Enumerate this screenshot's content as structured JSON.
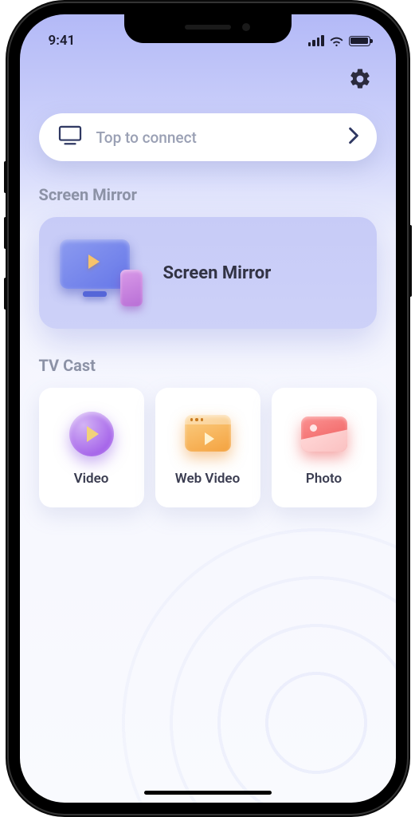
{
  "status": {
    "time": "9:41"
  },
  "connect": {
    "placeholder": "Top to connect"
  },
  "sections": {
    "mirror_title": "Screen Mirror",
    "mirror_card_label": "Screen Mirror",
    "cast_title": "TV Cast",
    "cast_items": [
      {
        "label": "Video"
      },
      {
        "label": "Web Video"
      },
      {
        "label": "Photo"
      }
    ]
  }
}
